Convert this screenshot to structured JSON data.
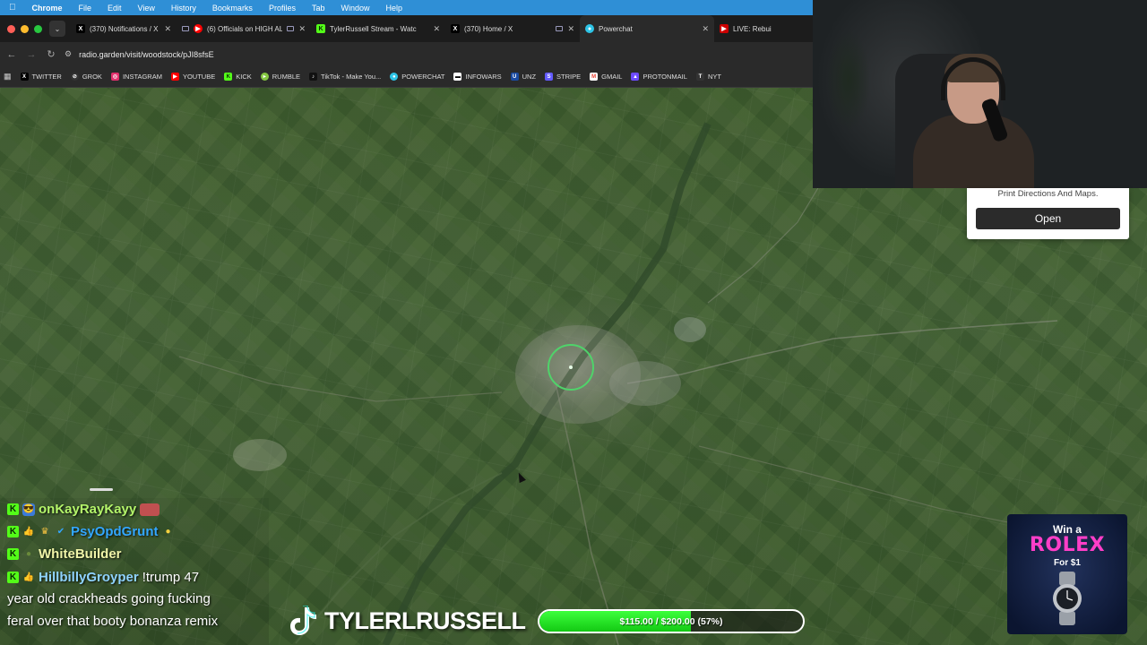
{
  "menubar": {
    "app": "Chrome",
    "items": [
      "File",
      "Edit",
      "View",
      "History",
      "Bookmarks",
      "Profiles",
      "Tab",
      "Window",
      "Help"
    ]
  },
  "tabs": [
    {
      "title": "(370) Notifications / X",
      "icon": "x-icon",
      "color": "#000000"
    },
    {
      "title": "(6) Officials on HIGH AL",
      "icon": "youtube-icon",
      "color": "#ff0000"
    },
    {
      "title": "TylerRussell Stream - Watc",
      "icon": "kick-icon",
      "color": "#53fc18"
    },
    {
      "title": "(370) Home / X",
      "icon": "x-icon",
      "color": "#000000"
    },
    {
      "title": "Powerchat",
      "icon": "powerchat-icon",
      "color": "#2ec4e6"
    },
    {
      "title": "LIVE: Rebuil",
      "icon": "live-icon",
      "color": "#cc0000"
    }
  ],
  "address": {
    "url": "radio.garden/visit/woodstock/pJI8sfsE"
  },
  "bookmarks": [
    {
      "label": "TWITTER",
      "icon": "x-icon",
      "color": "#000000"
    },
    {
      "label": "GROK",
      "icon": "grok-icon",
      "color": "#333333"
    },
    {
      "label": "INSTAGRAM",
      "icon": "instagram-icon",
      "color": "#e1306c"
    },
    {
      "label": "YOUTUBE",
      "icon": "youtube-icon",
      "color": "#ff0000"
    },
    {
      "label": "KICK",
      "icon": "kick-icon",
      "color": "#53fc18"
    },
    {
      "label": "RUMBLE",
      "icon": "rumble-icon",
      "color": "#85c742"
    },
    {
      "label": "TikTok - Make You...",
      "icon": "tiktok-icon",
      "color": "#111111"
    },
    {
      "label": "POWERCHAT",
      "icon": "powerchat-icon",
      "color": "#2ec4e6"
    },
    {
      "label": "INFOWARS",
      "icon": "infowars-icon",
      "color": "#ffffff"
    },
    {
      "label": "UNZ",
      "icon": "unz-icon",
      "color": "#1a4aa0"
    },
    {
      "label": "STRIPE",
      "icon": "stripe-icon",
      "color": "#635bff"
    },
    {
      "label": "GMAIL",
      "icon": "gmail-icon",
      "color": "#ea4335"
    },
    {
      "label": "PROTONMAIL",
      "icon": "protonmail-icon",
      "color": "#6d4aff"
    },
    {
      "label": "NYT",
      "icon": "nyt-icon",
      "color": "#333333"
    }
  ],
  "popup": {
    "text": "Print Directions And Maps.",
    "button": "Open"
  },
  "chat": {
    "messages": [
      {
        "user": "onKayRayKayy",
        "color": "#b4f56a",
        "text": ""
      },
      {
        "user": "PsyOpdGrunt",
        "color": "#33a7ff",
        "text": ""
      },
      {
        "user": "WhiteBuilder",
        "color": "#f0f4a8",
        "text": ""
      },
      {
        "user": "HillbillyGroyper",
        "color": "#8fd3ff",
        "text": "!trump 47"
      }
    ],
    "continuation": [
      "year old crackheads going fucking",
      "feral over that booty bonanza remix"
    ]
  },
  "brand": {
    "name": "TYLERLRUSSELL"
  },
  "goal": {
    "label": "$115.00 / $200.00 (57%)",
    "raised": 115.0,
    "target": 200.0,
    "percent": 57
  },
  "ad": {
    "line1": "Win a",
    "line2": "ROLEX",
    "line3": "For $1"
  },
  "colors": {
    "menubar": "#2f8fd6",
    "kick_green": "#53fc18",
    "locator": "#4fd36a",
    "rolex_pink": "#ff3ec8"
  }
}
